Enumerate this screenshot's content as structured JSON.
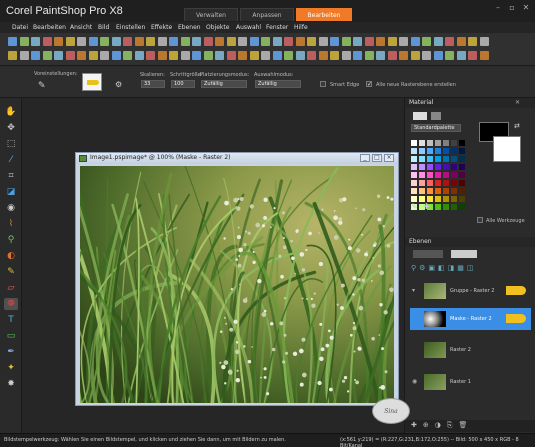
{
  "app": {
    "title": "Corel PaintShop Pro X8",
    "tabs": [
      {
        "label": "Verwalten"
      },
      {
        "label": "Anpassen"
      },
      {
        "label": "Bearbeiten"
      }
    ],
    "active_tab": "Bearbeiten"
  },
  "menu": [
    {
      "label": "Datei"
    },
    {
      "label": "Bearbeiten"
    },
    {
      "label": "Ansicht"
    },
    {
      "label": "Bild"
    },
    {
      "label": "Einstellen"
    },
    {
      "label": "Effekte"
    },
    {
      "label": "Ebenen"
    },
    {
      "label": "Objekte"
    },
    {
      "label": "Auswahl"
    },
    {
      "label": "Fenster"
    },
    {
      "label": "Hilfe"
    }
  ],
  "tool_options": {
    "presets_label": "Voreinstellungen:",
    "scale_label": "Skalieren:",
    "scale_value": "33",
    "step_label": "Schrittgröße:",
    "step_value": "100",
    "placement_label": "Platzierungsmodus:",
    "placement_value": "Zufällig",
    "selection_label": "Auswahlmodus:",
    "selection_value": "Zufällig",
    "smart_edge_label": "Smart Edge",
    "all_layers_label": "Alle neue Rasterebene erstellen"
  },
  "image_window": {
    "title": "Image1.pspimage* @ 100% (Maske - Raster 2)"
  },
  "material_panel": {
    "title": "Material",
    "mode_value": "Standardpalette",
    "all_tools_label": "Alle Werkzeuge"
  },
  "layers_panel": {
    "title": "Ebenen",
    "layers": [
      {
        "name": "Gruppe - Raster 2",
        "selected": false
      },
      {
        "name": "Maske - Raster 2",
        "selected": true
      },
      {
        "name": "Raster 2",
        "selected": false
      },
      {
        "name": "Raster 1",
        "selected": false
      }
    ]
  },
  "status": {
    "hint": "Bildstempelwerkzeug: Wählen Sie einen Bildstempel, und klicken und ziehen Sie dann, um mit Bildern zu malen.",
    "right": "(x:561 y:219) = (R:227,G:231,B:172,O:255) -- Bild: 500 x 450 x RGB - 8 Bit/Kanal"
  },
  "colors": {
    "accent": "#f07a28",
    "highlight": "#3a8ee6",
    "panel_bg": "#2b2b2b"
  }
}
